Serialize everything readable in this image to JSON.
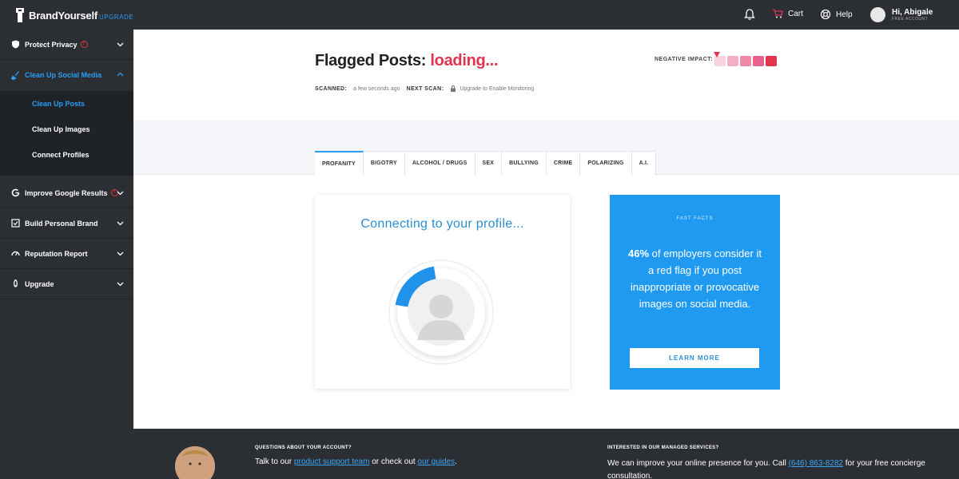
{
  "brand": {
    "name": "BrandYourself",
    "tag": "UPGRADE"
  },
  "topbar": {
    "cart_label": "Cart",
    "help_label": "Help",
    "user_greeting": "Hi, Abigale",
    "user_plan": "FREE ACCOUNT",
    "icons": [
      "bell-icon",
      "cart-icon",
      "help-icon"
    ]
  },
  "sidebar": {
    "items": [
      {
        "label": "Protect Privacy",
        "icon": "shield-icon",
        "warn": true
      },
      {
        "label": "Clean Up Social Media",
        "icon": "broom-icon",
        "active": true
      },
      {
        "label": "Improve Google Results",
        "icon": "google-icon",
        "warn": true
      },
      {
        "label": "Build Personal Brand",
        "icon": "checklist-icon"
      },
      {
        "label": "Reputation Report",
        "icon": "gauge-icon"
      },
      {
        "label": "Upgrade",
        "icon": "rocket-icon"
      }
    ],
    "sub_items": [
      "Clean Up Posts",
      "Clean Up Images",
      "Connect Profiles"
    ],
    "accent": "#2a9df4"
  },
  "header": {
    "title_prefix": "Flagged Posts:",
    "title_status": "loading...",
    "negative_impact_label": "NEGATIVE IMPACT:",
    "scanned_label": "SCANNED:",
    "scanned_value": "a few seconds ago",
    "next_scan_label": "NEXT SCAN:",
    "next_scan_value": "Upgrade to Enable Monitoring",
    "impact_colors": [
      "#f8d3de",
      "#f3aec3",
      "#ee8aa8",
      "#e8618a",
      "#e0344f"
    ]
  },
  "tabs": [
    "PROFANITY",
    "BIGOTRY",
    "ALCOHOL / DRUGS",
    "SEX",
    "BULLYING",
    "CRIME",
    "POLARIZING",
    "A.I."
  ],
  "progress_card": {
    "text": "Connecting to your profile...",
    "progress_fraction": 0.2
  },
  "facts_card": {
    "heading": "FAST FACTS",
    "stat": "46%",
    "body": " of employers consider it a red flag if you post inappropriate or provocative images on social media.",
    "button_label": "LEARN MORE"
  },
  "footer": {
    "q1": "QUESTIONS ABOUT YOUR ACCOUNT?",
    "t1_pre": "Talk to our ",
    "t1_link1": "product support team",
    "t1_mid": " or check out ",
    "t1_link2": "our guides",
    "t1_post": ".",
    "q2": "INTERESTED IN OUR MANAGED SERVICES?",
    "t2_pre": "We can improve your online presence for you. Call ",
    "t2_phone": "(646) 863-8282",
    "t2_post": " for your free concierge consultation."
  }
}
